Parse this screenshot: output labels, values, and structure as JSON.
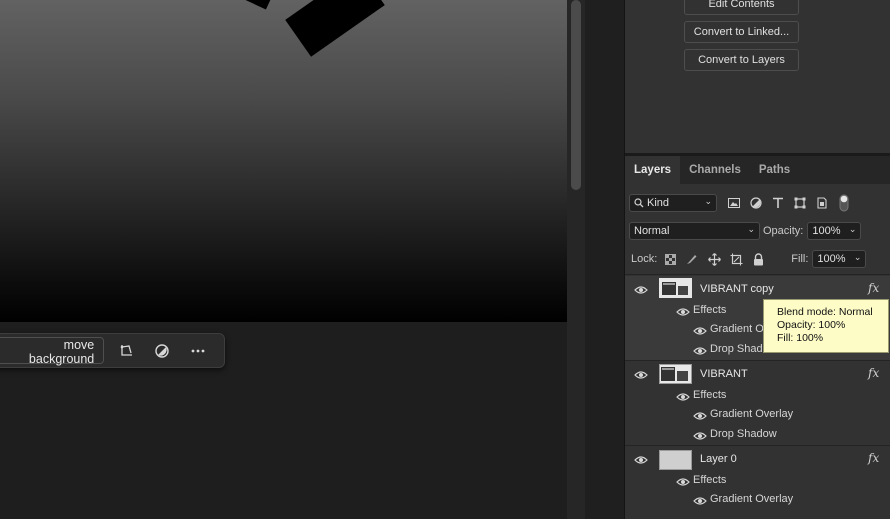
{
  "canvas": {
    "context_bar": {
      "remove_background_label": "move background"
    }
  },
  "properties": {
    "buttons": {
      "edit_contents": "Edit Contents",
      "convert_linked": "Convert to Linked...",
      "convert_layers": "Convert to Layers"
    }
  },
  "layers_panel": {
    "tabs": [
      {
        "label": "Layers",
        "active": true
      },
      {
        "label": "Channels",
        "active": false
      },
      {
        "label": "Paths",
        "active": false
      }
    ],
    "filter": {
      "kind_label": "Kind"
    },
    "blend_mode": "Normal",
    "opacity_label": "Opacity:",
    "opacity_value": "100%",
    "lock_label": "Lock:",
    "fill_label": "Fill:",
    "fill_value": "100%",
    "layers": [
      {
        "name": "VIBRANT copy",
        "selected": true,
        "effects_label": "Effects",
        "effects": [
          "Gradient Overlay",
          "Drop Shadow"
        ],
        "fx": "fx"
      },
      {
        "name": "VIBRANT",
        "selected": false,
        "effects_label": "Effects",
        "effects": [
          "Gradient Overlay",
          "Drop Shadow"
        ],
        "fx": "fx"
      },
      {
        "name": "Layer 0",
        "selected": false,
        "effects_label": "Effects",
        "effects": [
          "Gradient Overlay"
        ],
        "fx": "fx"
      }
    ]
  },
  "tooltip": {
    "blend": "Blend mode: Normal",
    "opacity": "Opacity: 100%",
    "fill": "Fill: 100%"
  }
}
